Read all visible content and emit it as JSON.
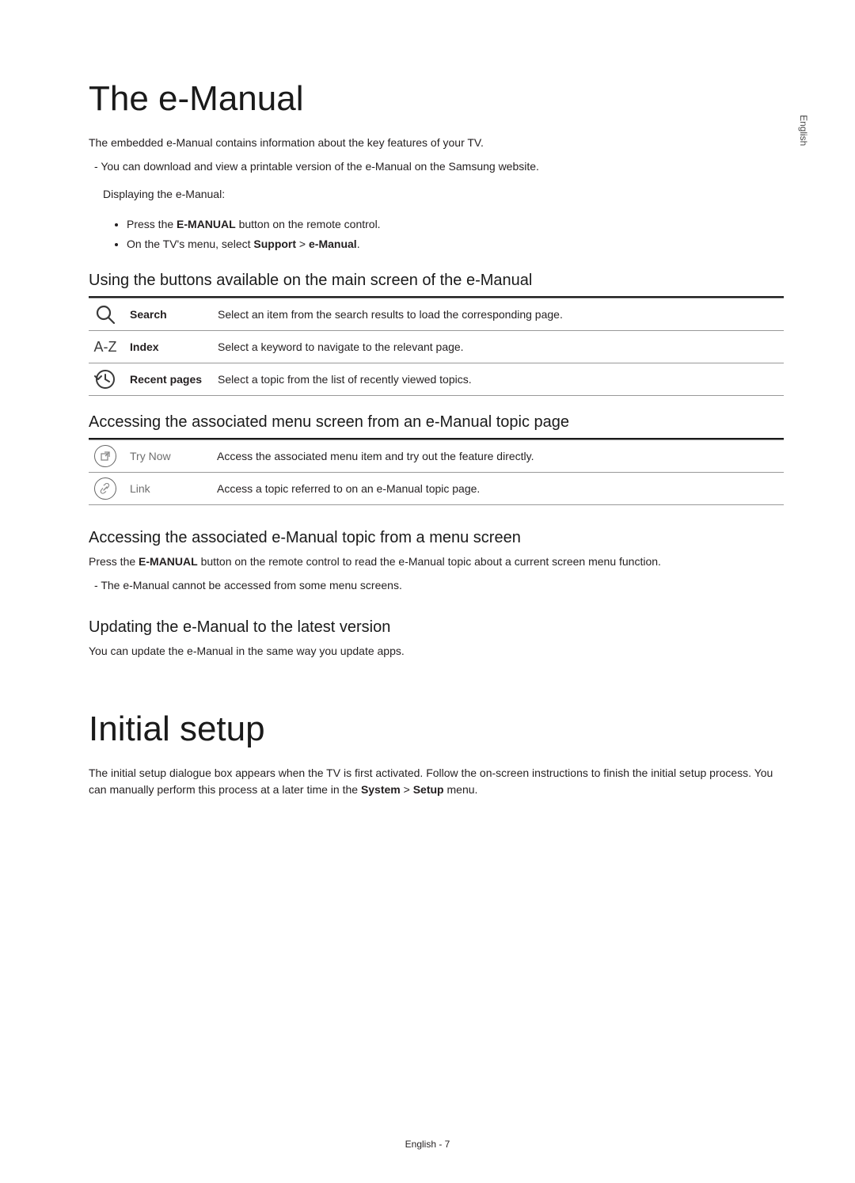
{
  "side_label": "English",
  "s1": {
    "title": "The e-Manual",
    "intro": "The embedded e-Manual contains information about the key features of your TV.",
    "note": "You can download and view a printable version of the e-Manual on the Samsung website.",
    "displaying": "Displaying the e-Manual:",
    "bullets": {
      "b1_pre": "Press the ",
      "b1_bold": "E-MANUAL",
      "b1_post": " button on the remote control.",
      "b2_pre": "On the TV's menu, select ",
      "b2_b1": "Support",
      "b2_mid": " > ",
      "b2_b2": "e-Manual",
      "b2_post": "."
    },
    "sub1": {
      "heading": "Using the buttons available on the main screen of the e-Manual",
      "r1_name": "Search",
      "r1_desc": "Select an item from the search results to load the corresponding page.",
      "r2_icon": "A-Z",
      "r2_name": "Index",
      "r2_desc": "Select a keyword to navigate to the relevant page.",
      "r3_name": "Recent pages",
      "r3_desc": "Select a topic from the list of recently viewed topics."
    },
    "sub2": {
      "heading": "Accessing the associated menu screen from an e-Manual topic page",
      "r1_name": "Try Now",
      "r1_desc": "Access the associated menu item and try out the feature directly.",
      "r2_name": "Link",
      "r2_desc": "Access a topic referred to on an e-Manual topic page."
    },
    "sub3": {
      "heading": "Accessing the associated e-Manual topic from a menu screen",
      "line1_pre": "Press the ",
      "line1_bold": "E-MANUAL",
      "line1_post": " button on the remote control to read the e-Manual topic about a current screen menu function.",
      "dash": "The e-Manual cannot be accessed from some menu screens."
    },
    "sub4": {
      "heading": "Updating the e-Manual to the latest version",
      "body": "You can update the e-Manual in the same way you update apps."
    }
  },
  "s2": {
    "title": "Initial setup",
    "p_pre": "The initial setup dialogue box appears when the TV is first activated. Follow the on-screen instructions to finish the initial setup process. You can manually perform this process at a later time in the ",
    "p_b1": "System",
    "p_mid": " > ",
    "p_b2": "Setup",
    "p_post": " menu."
  },
  "footer": "English - 7"
}
